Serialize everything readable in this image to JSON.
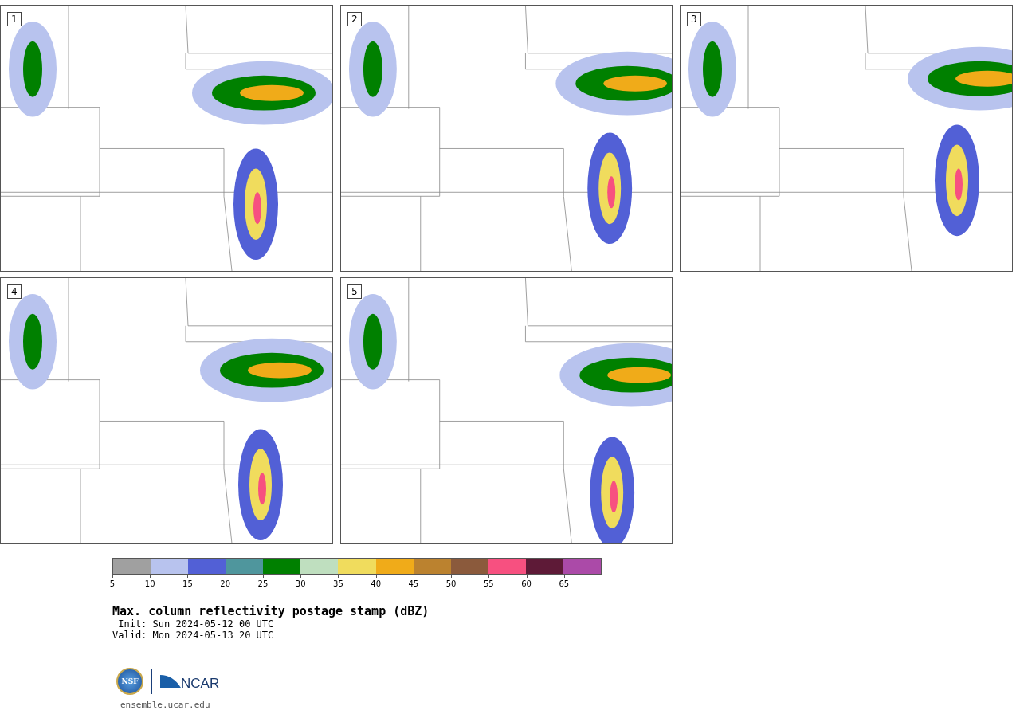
{
  "panels": [
    {
      "label": "1"
    },
    {
      "label": "2"
    },
    {
      "label": "3"
    },
    {
      "label": "4"
    },
    {
      "label": "5"
    }
  ],
  "colorbar": [
    {
      "label": "5",
      "color": "#a0a0a0"
    },
    {
      "label": "10",
      "color": "#b8c3ee"
    },
    {
      "label": "15",
      "color": "#5260d6"
    },
    {
      "label": "20",
      "color": "#4f969d"
    },
    {
      "label": "25",
      "color": "#008000"
    },
    {
      "label": "30",
      "color": "#bfdfbf"
    },
    {
      "label": "35",
      "color": "#f0dc5d"
    },
    {
      "label": "40",
      "color": "#f0ab19"
    },
    {
      "label": "45",
      "color": "#bb822f"
    },
    {
      "label": "50",
      "color": "#8b5a3c"
    },
    {
      "label": "55",
      "color": "#f75080"
    },
    {
      "label": "60",
      "color": "#5e1a37"
    },
    {
      "label": "65",
      "color": "#ab4aa8"
    }
  ],
  "title": "Max. column reflectivity postage stamp (dBZ)",
  "init": " Init: Sun 2024-05-12 00 UTC",
  "valid": "Valid: Mon 2024-05-13 20 UTC",
  "logos": {
    "nsf": "NSF",
    "ncar": "NCAR"
  },
  "url": "ensemble.ucar.edu"
}
